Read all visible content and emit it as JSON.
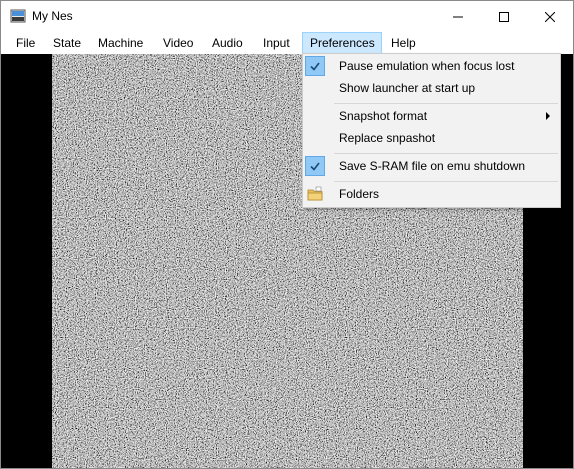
{
  "window": {
    "title": "My Nes"
  },
  "menubar": {
    "items": [
      {
        "label": "File"
      },
      {
        "label": "State"
      },
      {
        "label": "Machine"
      },
      {
        "label": "Video"
      },
      {
        "label": "Audio"
      },
      {
        "label": "Input"
      },
      {
        "label": "Preferences"
      },
      {
        "label": "Help"
      }
    ],
    "open_menu": "Preferences"
  },
  "preferences_menu": {
    "items": [
      {
        "label": "Pause emulation when focus lost",
        "checked": true
      },
      {
        "label": "Show launcher at start up",
        "checked": false
      },
      {
        "label": "Snapshot format",
        "submenu": true
      },
      {
        "label": "Replace snpashot"
      },
      {
        "label": "Save S-RAM file on emu shutdown",
        "checked": true
      },
      {
        "label": "Folders",
        "icon": "folder-icon"
      }
    ]
  },
  "colors": {
    "menu_highlight": "#cce8ff",
    "check_bg": "#90c8f6",
    "display_bg": "#000000"
  },
  "icons": [
    "app-icon",
    "minimize-icon",
    "maximize-icon",
    "close-icon",
    "check-icon",
    "submenu-arrow-icon",
    "folder-icon"
  ]
}
